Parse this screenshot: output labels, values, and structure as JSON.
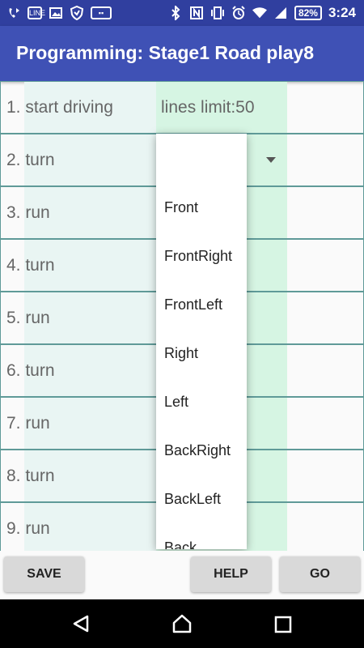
{
  "status_bar": {
    "notification_icons": [
      "call-forward-icon",
      "line-icon",
      "image-icon",
      "shield-icon",
      "app-icon"
    ],
    "system_icons": [
      "bluetooth-icon",
      "nfc-icon",
      "vibrate-icon",
      "alarm-icon",
      "wifi-icon",
      "signal-icon"
    ],
    "battery": "82%",
    "time": "3:24"
  },
  "app_bar": {
    "title": "Programming: Stage1 Road play8"
  },
  "program": {
    "lines_limit": "lines limit:50",
    "rows": [
      {
        "label": "1. start driving"
      },
      {
        "label": "2. turn"
      },
      {
        "label": "3. run"
      },
      {
        "label": "4. turn"
      },
      {
        "label": "5. run"
      },
      {
        "label": "6. turn"
      },
      {
        "label": "7. run"
      },
      {
        "label": "8. turn"
      },
      {
        "label": "9. run"
      }
    ]
  },
  "dropdown": {
    "options": [
      "Front",
      "FrontRight",
      "FrontLeft",
      "Right",
      "Left",
      "BackRight",
      "BackLeft",
      "Back"
    ]
  },
  "buttons": {
    "save": "SAVE",
    "help": "HELP",
    "go": "GO"
  },
  "nav_bar": {
    "icons": [
      "back-icon",
      "home-icon",
      "recents-icon"
    ]
  },
  "colors": {
    "status_bar": "#303f9f",
    "app_bar": "#3f51b5",
    "label_column": "#e9f5f3",
    "value_column": "#d6f5e3",
    "row_border": "#5f9a98"
  }
}
